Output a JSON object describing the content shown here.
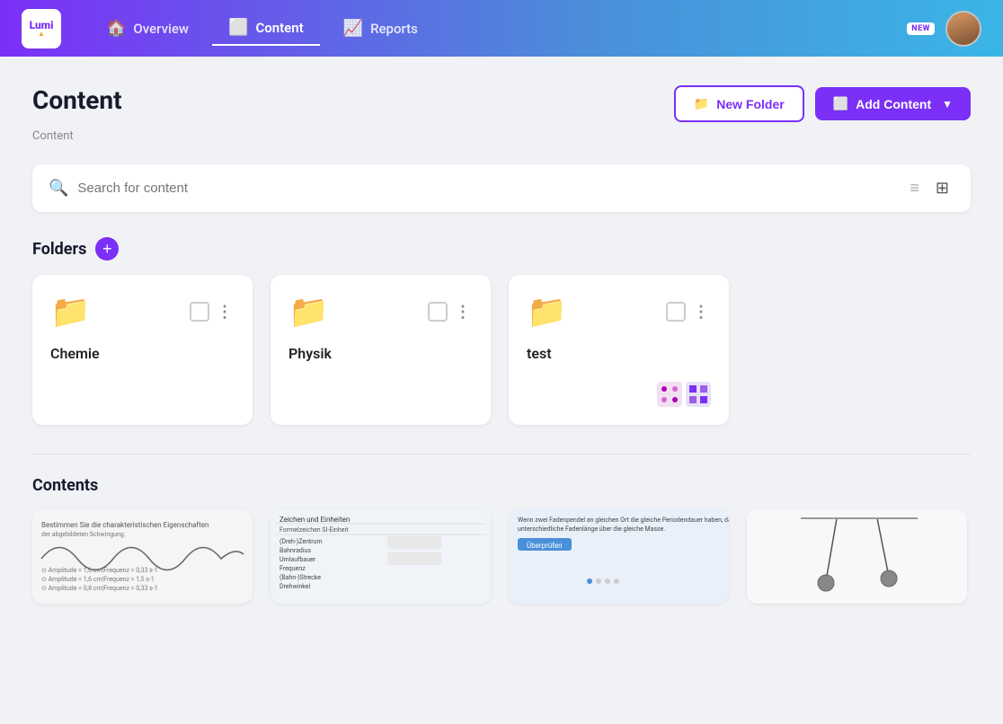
{
  "nav": {
    "logo": "Lumi",
    "items": [
      {
        "id": "overview",
        "label": "Overview",
        "icon": "🏠",
        "active": false
      },
      {
        "id": "content",
        "label": "Content",
        "icon": "📄",
        "active": true
      },
      {
        "id": "reports",
        "label": "Reports",
        "icon": "📈",
        "active": false
      }
    ],
    "new_badge": "NEW"
  },
  "page": {
    "title": "Content",
    "breadcrumb": "Content",
    "btn_new_folder": "New Folder",
    "btn_add_content": "Add Content"
  },
  "search": {
    "placeholder": "Search for content"
  },
  "folders_section": {
    "title": "Folders",
    "folders": [
      {
        "name": "Chemie",
        "color": "#f5a623",
        "has_thumbs": false
      },
      {
        "name": "Physik",
        "color": "#aaa",
        "has_thumbs": false
      },
      {
        "name": "test",
        "color": "#b300b3",
        "has_thumbs": true
      }
    ]
  },
  "contents_section": {
    "title": "Contents",
    "items": [
      {
        "id": 1
      },
      {
        "id": 2
      },
      {
        "id": 3
      },
      {
        "id": 4
      }
    ]
  }
}
